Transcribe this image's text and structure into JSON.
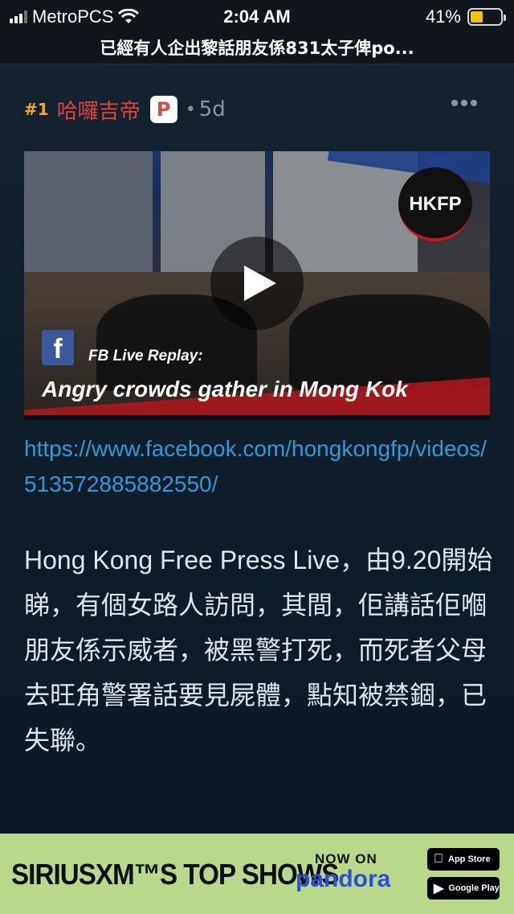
{
  "status_bar": {
    "carrier": "MetroPCS",
    "time": "2:04 AM",
    "battery_percent": "41%",
    "battery_level": 0.41
  },
  "title_bar": {
    "title": "已經有人企出黎話朋友係831太子俾po..."
  },
  "post": {
    "number": "#1",
    "author": "哈囉吉帝",
    "badge": "P",
    "separator": "•",
    "age": "5d",
    "link": "https://www.facebook.com/hongkongfp/videos/513572885882550/",
    "body": "Hong Kong Free Press Live，由9.20開始睇，有個女路人訪問，其間，佢講話佢嗰朋友係示威者，被黑警打死，而死者父母去旺角警署話要見屍體，點知被禁錮，已失聯。"
  },
  "video": {
    "logo": "HKFP",
    "fb_glyph": "f",
    "fb_label": "FB Live Replay:",
    "caption": "Angry crowds gather in Mong Kok"
  },
  "ad": {
    "headline": "SIRIUSXM™S TOP SHOWS",
    "now_on": "NOW ON",
    "brand": "pandora",
    "app_store": "App Store",
    "google_play": "Google Play"
  },
  "colors": {
    "accent_number": "#f5a623",
    "author": "#e0453a",
    "link": "#2e9bd8",
    "ad_background": "#b9d88a"
  }
}
